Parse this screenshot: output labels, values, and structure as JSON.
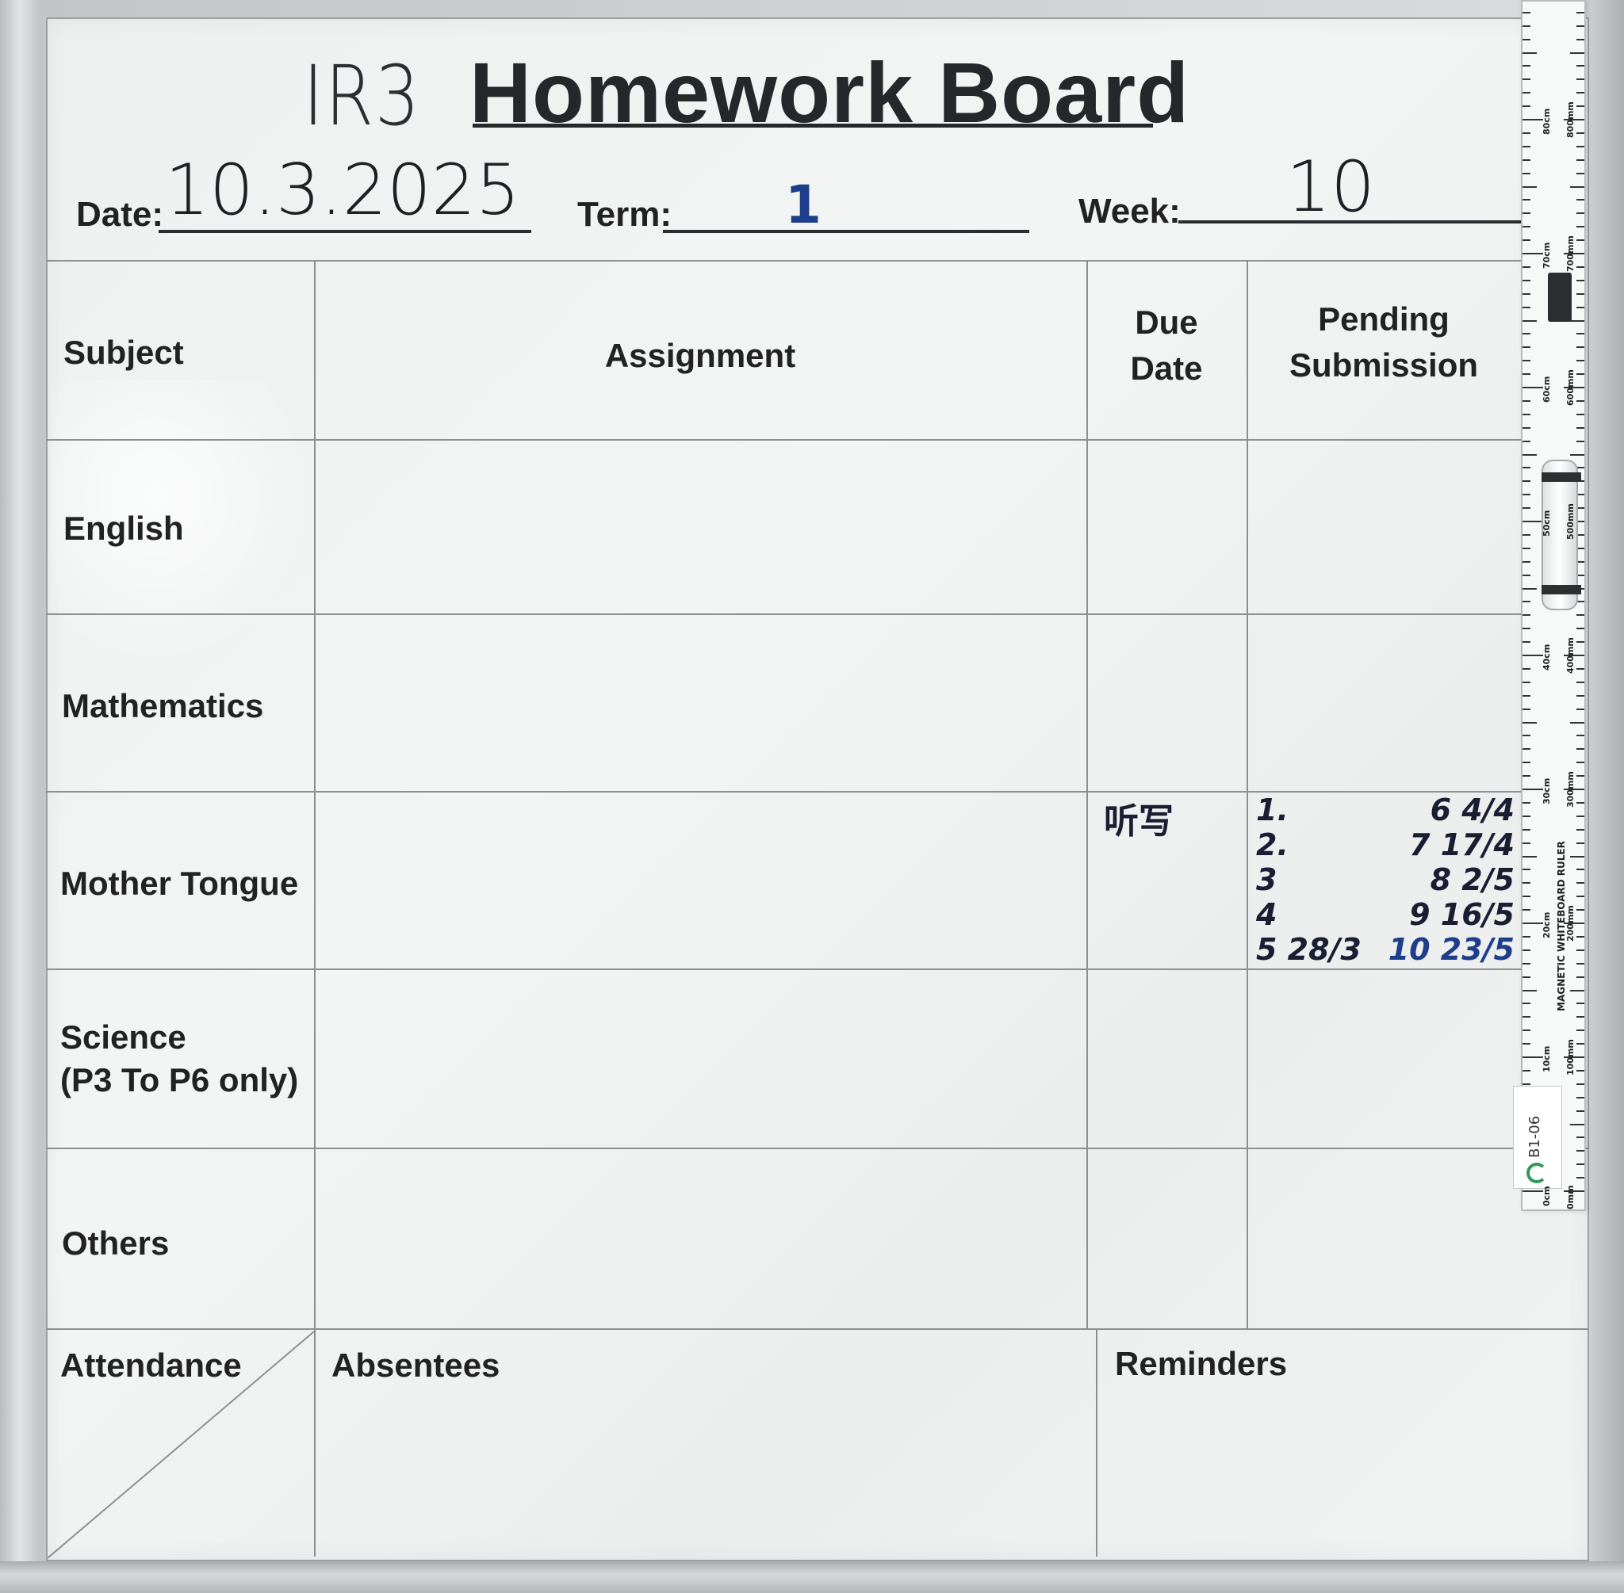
{
  "header": {
    "class_name": "IR3",
    "title": "Homework Board",
    "date_label": "Date:",
    "date_value": "10.3.2025",
    "term_label": "Term:",
    "term_value": "1",
    "week_label": "Week:",
    "week_value": "10"
  },
  "table": {
    "headers": {
      "subject": "Subject",
      "assignment": "Assignment",
      "due_date_line1": "Due",
      "due_date_line2": "Date",
      "pending_line1": "Pending",
      "pending_line2": "Submission"
    },
    "subjects": {
      "english": "English",
      "mathematics": "Mathematics",
      "mother_tongue": "Mother Tongue",
      "science_line1": "Science",
      "science_line2": "(P3 To P6 only)",
      "others": "Others"
    },
    "mother_tongue_due": "听写",
    "pending_left": [
      "1.",
      "2.",
      "3",
      "4",
      "5 28/3"
    ],
    "pending_right": [
      "6 4/4",
      "7 17/4",
      "8 2/5",
      "9 16/5",
      "10 23/5"
    ]
  },
  "footer": {
    "attendance": "Attendance",
    "absentees": "Absentees",
    "reminders": "Reminders"
  },
  "ruler": {
    "brand": "MAGNETIC WHITEBOARD RULER",
    "tag": "B1-06",
    "cm_labels": [
      "0cm",
      "10cm",
      "20cm",
      "30cm",
      "40cm",
      "50cm",
      "60cm",
      "70cm",
      "80cm"
    ],
    "mm_labels": [
      "0mm",
      "100mm",
      "200mm",
      "300mm",
      "400mm",
      "500mm",
      "600mm",
      "700mm",
      "800mm"
    ]
  },
  "colors": {
    "marker_black": "#1d1f22",
    "marker_blue": "#1e3d8a",
    "board": "#f0f2f2",
    "frame": "#c3c6c7"
  }
}
